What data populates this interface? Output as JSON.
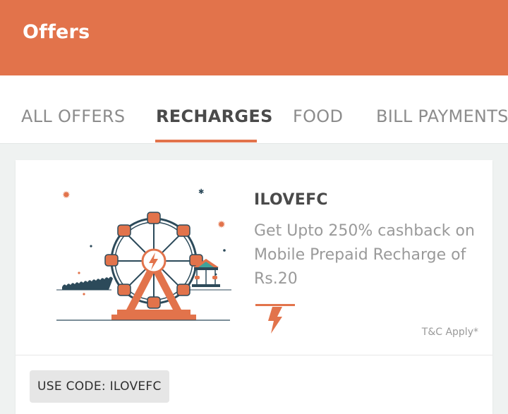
{
  "appbar": {
    "title": "Offers"
  },
  "tabs": [
    {
      "label": "ALL OFFERS"
    },
    {
      "label": "RECHARGES"
    },
    {
      "label": "FOOD"
    },
    {
      "label": "BILL PAYMENTS"
    }
  ],
  "active_tab": "RECHARGES",
  "offer": {
    "code": "ILOVEFC",
    "description": "Get Upto 250% cashback on Mobile Prepaid Recharge of Rs.20",
    "tnc": "T&C Apply*",
    "use_code_label": "USE CODE: ILOVEFC"
  },
  "colors": {
    "accent": "#e2734b",
    "wheel_structure": "#2c4a5a",
    "background": "#eff2f1"
  },
  "icons": {
    "illustration": "ferris-wheel-illustration",
    "brand": "lightning-bolt-logo"
  }
}
